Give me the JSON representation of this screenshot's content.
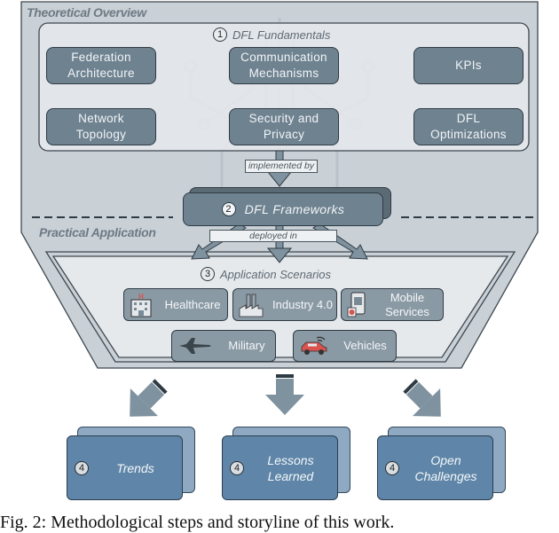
{
  "sections": {
    "theoretical": "Theoretical Overview",
    "practical": "Practical Application"
  },
  "step1": {
    "number": "1",
    "title": "DFL Fundamentals",
    "boxes": [
      {
        "line1": "Federation",
        "line2": "Architecture"
      },
      {
        "line1": "Communication",
        "line2": "Mechanisms"
      },
      {
        "line1": "KPIs",
        "line2": ""
      },
      {
        "line1": "Network",
        "line2": "Topology"
      },
      {
        "line1": "Security and",
        "line2": "Privacy"
      },
      {
        "line1": "DFL",
        "line2": "Optimizations"
      }
    ]
  },
  "connector1": "implemented by",
  "step2": {
    "number": "2",
    "title": "DFL Frameworks"
  },
  "connector2": "deployed in",
  "step3": {
    "number": "3",
    "title": "Application Scenarios",
    "scenarios": [
      {
        "line1": "Healthcare",
        "line2": "",
        "icon": "hospital-icon"
      },
      {
        "line1": "Industry 4.0",
        "line2": "",
        "icon": "factory-icon"
      },
      {
        "line1": "Mobile",
        "line2": "Services",
        "icon": "mobile-phone-icon"
      },
      {
        "line1": "Military",
        "line2": "",
        "icon": "fighter-jet-icon"
      },
      {
        "line1": "Vehicles",
        "line2": "",
        "icon": "connected-car-icon"
      }
    ]
  },
  "step4": [
    {
      "number": "4",
      "line1": "Trends",
      "line2": ""
    },
    {
      "number": "4",
      "line1": "Lessons",
      "line2": "Learned"
    },
    {
      "number": "4",
      "line1": "Open",
      "line2": "Challenges"
    }
  ],
  "caption": "Fig. 2: Methodological steps and storyline of this work.",
  "colors": {
    "outer_panel": "#c9d0d6",
    "inner_panel": "#e6e9ec",
    "fund_box": "#6e8290",
    "app_box": "#8a9aa5",
    "result_front": "#5f86a8",
    "result_back": "#8ea9c1",
    "arrow": "#7f929f"
  }
}
